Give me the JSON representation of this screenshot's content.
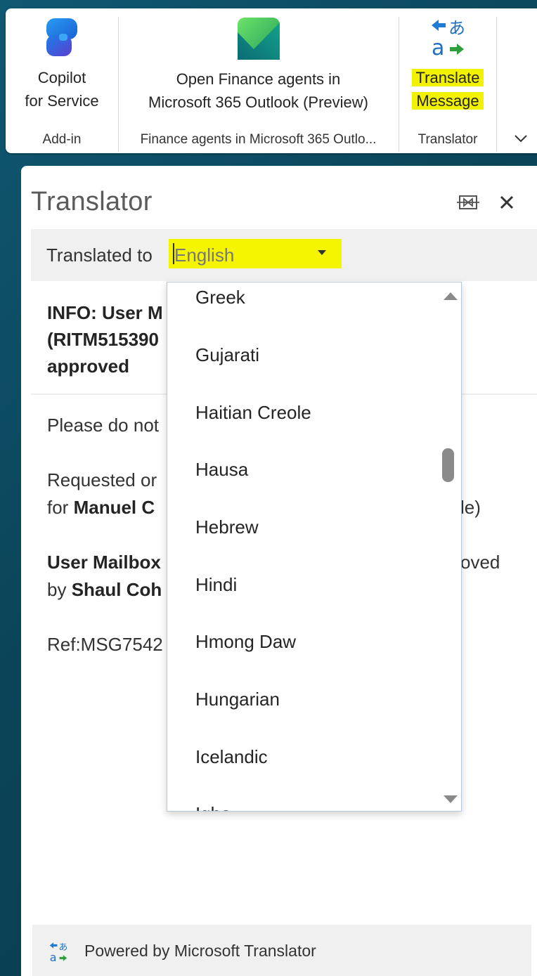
{
  "ribbon": {
    "groups": [
      {
        "button_line1": "Copilot",
        "button_line2": "for Service",
        "group_name": "Add-in",
        "icon": "copilot-icon"
      },
      {
        "button_line1": "Open Finance agents in",
        "button_line2": "Microsoft 365 Outlook (Preview)",
        "group_name": "Finance agents in Microsoft 365 Outlo...",
        "icon": "finance-agents-icon"
      },
      {
        "button_line1": "Translate",
        "button_line2": "Message",
        "group_name": "Translator",
        "icon": "translator-icon",
        "highlight_color": "#f2f200"
      }
    ],
    "expand_icon": "chevron-down-icon"
  },
  "pane": {
    "title": "Translator",
    "pin_icon": "pin-icon",
    "close_icon": "close-icon",
    "translated_to_label": "Translated to",
    "selected_language": "English",
    "highlight_color": "#f5f500"
  },
  "email": {
    "subject_lines": [
      "INFO: User M",
      "(RITM515390",
      "approved"
    ],
    "body": {
      "line1": "Please do not",
      "line2": "Requested or",
      "line3_prefix": "for ",
      "line3_bold": "Manuel C",
      "line3_suffix": "le)",
      "line4_bold": "User Mailbox",
      "line4_suffix": "oved",
      "line5_prefix": "by ",
      "line5_bold": "Shaul Coh",
      "line6": "Ref:MSG7542"
    }
  },
  "dropdown": {
    "options": [
      "Greek",
      "Gujarati",
      "Haitian Creole",
      "Hausa",
      "Hebrew",
      "Hindi",
      "Hmong Daw",
      "Hungarian",
      "Icelandic",
      "Igbo"
    ],
    "scroll_position": 0.35
  },
  "footer": {
    "text": "Powered by Microsoft Translator",
    "icon": "translator-icon"
  }
}
